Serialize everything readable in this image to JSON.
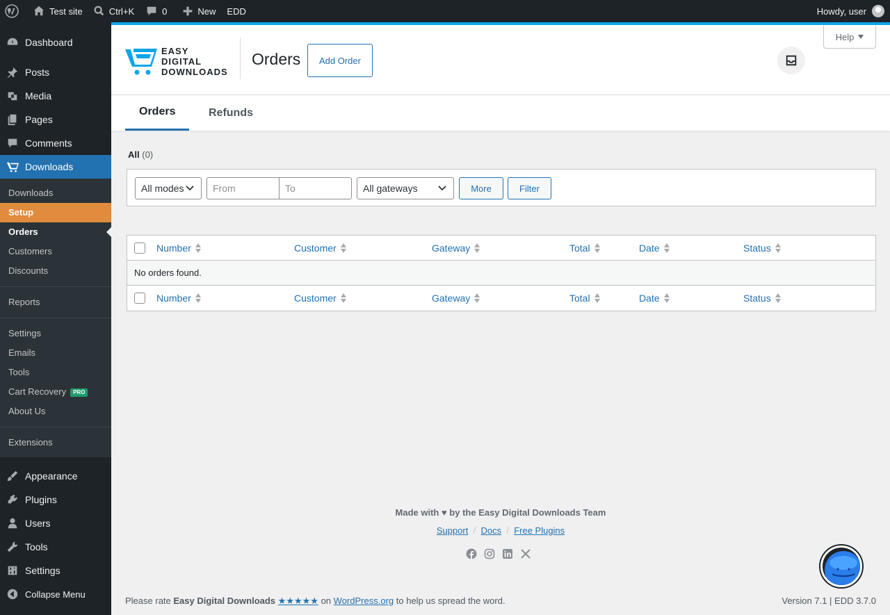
{
  "adminbar": {
    "site_name": "Test site",
    "search_shortcut": "Ctrl+K",
    "comments_count": "0",
    "new_label": "New",
    "edd_label": "EDD",
    "howdy": "Howdy, user"
  },
  "sidebar": {
    "top": [
      {
        "label": "Dashboard",
        "icon": "dashboard-icon"
      },
      {
        "label": "Posts",
        "icon": "pin-icon"
      },
      {
        "label": "Media",
        "icon": "media-icon"
      },
      {
        "label": "Pages",
        "icon": "pages-icon"
      },
      {
        "label": "Comments",
        "icon": "comment-icon"
      },
      {
        "label": "Downloads",
        "icon": "edd-icon"
      }
    ],
    "sub": [
      {
        "label": "Downloads"
      },
      {
        "label": "Setup"
      },
      {
        "label": "Orders"
      },
      {
        "label": "Customers"
      },
      {
        "label": "Discounts"
      },
      {
        "label": "Reports"
      },
      {
        "label": "Settings"
      },
      {
        "label": "Emails"
      },
      {
        "label": "Tools"
      },
      {
        "label": "Cart Recovery",
        "badge": "PRO"
      },
      {
        "label": "About Us"
      },
      {
        "label": "Extensions"
      }
    ],
    "bottom": [
      {
        "label": "Appearance",
        "icon": "brush-icon"
      },
      {
        "label": "Plugins",
        "icon": "plugin-icon"
      },
      {
        "label": "Users",
        "icon": "user-icon"
      },
      {
        "label": "Tools",
        "icon": "wrench-icon"
      },
      {
        "label": "Settings",
        "icon": "settings-icon"
      },
      {
        "label": "Collapse Menu",
        "icon": "collapse-icon"
      }
    ]
  },
  "header": {
    "logo_line1": "EASY",
    "logo_line2": "DIGITAL",
    "logo_line3": "DOWNLOADS",
    "title": "Orders",
    "add_order": "Add Order",
    "help": "Help"
  },
  "tabs": [
    {
      "label": "Orders",
      "active": true
    },
    {
      "label": "Refunds",
      "active": false
    }
  ],
  "views": {
    "all_label": "All",
    "all_count": "(0)"
  },
  "filters": {
    "mode": "All modes",
    "from_placeholder": "From",
    "to_placeholder": "To",
    "gateway": "All gateways",
    "more": "More",
    "filter": "Filter"
  },
  "table": {
    "columns": [
      "Number",
      "Customer",
      "Gateway",
      "Total",
      "Date",
      "Status"
    ],
    "empty": "No orders found."
  },
  "footer": {
    "made_with": "Made with ♥ by the Easy Digital Downloads Team",
    "links": [
      "Support",
      "Docs",
      "Free Plugins"
    ],
    "link_sep": "/",
    "rate_prefix": "Please rate",
    "rate_name": "Easy Digital Downloads",
    "rate_stars": "★★★★★",
    "rate_on": "on",
    "rate_site": "WordPress.org",
    "rate_suffix": "to help us spread the word.",
    "version": "Version 7.1 | EDD 3.7.0"
  },
  "colors": {
    "accent": "#2271b1",
    "topline": "#0ea5e9",
    "setup": "#e08b3e"
  }
}
